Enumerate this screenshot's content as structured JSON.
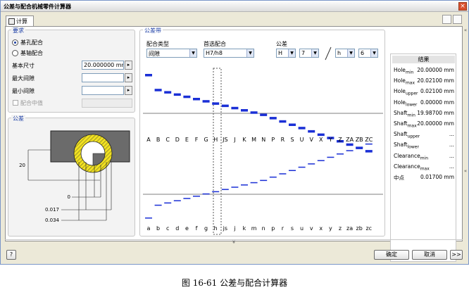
{
  "window": {
    "title": "公差与配合机械零件计算器"
  },
  "tab": {
    "label": "计算"
  },
  "requirements": {
    "title": "要求",
    "radio_hole": "基孔配合",
    "radio_shaft": "基轴配合",
    "selected": "hole",
    "basic_size_label": "基本尺寸",
    "basic_size_value": "20.000000 mm",
    "max_clearance_label": "最大间隙",
    "min_clearance_label": "最小间隙",
    "center_fit_label": "配合中值"
  },
  "tolerance_group": {
    "title": "公差",
    "dim_20": "20",
    "dim_0": "0",
    "dim_017": "0.017",
    "dim_034": "0.034"
  },
  "tolerance_zones": {
    "title": "公差带",
    "fit_type_label": "配合类型",
    "fit_type_value": "间隙",
    "preferred_fit_label": "首选配合",
    "preferred_fit_value": "H7/h8",
    "tolerance_label": "公差",
    "hole_letter": "H",
    "hole_grade": "7",
    "shaft_letter": "h",
    "shaft_grade": "6",
    "hole_letters": [
      "A",
      "B",
      "C",
      "D",
      "E",
      "F",
      "G",
      "H",
      "JS",
      "J",
      "K",
      "M",
      "N",
      "P",
      "R",
      "S",
      "U",
      "V",
      "X",
      "Y",
      "Z",
      "ZA",
      "ZB",
      "ZC"
    ],
    "shaft_letters": [
      "a",
      "b",
      "c",
      "d",
      "e",
      "f",
      "g",
      "h",
      "js",
      "j",
      "k",
      "m",
      "n",
      "p",
      "r",
      "s",
      "u",
      "v",
      "x",
      "y",
      "z",
      "za",
      "zb",
      "zc"
    ]
  },
  "results": {
    "title": "结果",
    "rows": [
      {
        "name": "Hole",
        "sub": "min",
        "value": "20.00000 mm"
      },
      {
        "name": "Hole",
        "sub": "max",
        "value": "20.02100 mm"
      },
      {
        "name": "Hole",
        "sub": "upper",
        "value": "0.02100 mm"
      },
      {
        "name": "Hole",
        "sub": "lower",
        "value": "0.00000 mm"
      },
      {
        "name": "Shaft",
        "sub": "min",
        "value": "19.98700 mm"
      },
      {
        "name": "Shaft",
        "sub": "max",
        "value": "20.00000 mm"
      },
      {
        "name": "Shaft",
        "sub": "upper",
        "value": "..."
      },
      {
        "name": "Shaft",
        "sub": "lower",
        "value": "..."
      },
      {
        "name": "Clearance",
        "sub": "min",
        "value": "..."
      },
      {
        "name": "Clearance",
        "sub": "max",
        "value": "..."
      },
      {
        "name": "中点",
        "sub": "",
        "value": "0.01700 mm"
      }
    ]
  },
  "buttons": {
    "ok": "确定",
    "cancel": "取消",
    "more": ">>",
    "help": "?"
  },
  "caption": "图 16-61  公差与配合计算器",
  "colors": {
    "accent": "#1b3ea6",
    "tolerance_bar": "#1a2fd6",
    "hatch": "#f0e020"
  }
}
